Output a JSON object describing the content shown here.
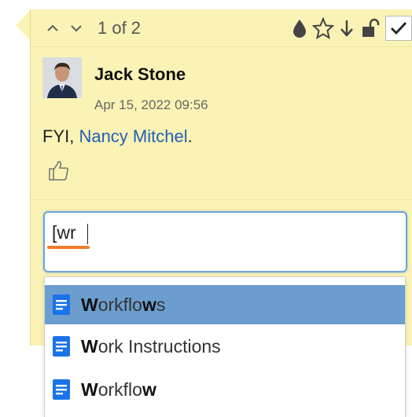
{
  "header": {
    "counter": "1 of 2",
    "icons": [
      "chevron-up-icon",
      "chevron-down-icon",
      "droplet-icon",
      "star-icon",
      "arrow-down-icon",
      "unlock-icon",
      "check-icon"
    ]
  },
  "comment": {
    "author": "Jack Stone",
    "date": "Apr 15, 2022 09:56",
    "text_prefix": "FYI, ",
    "mention": "Nancy Mitchel",
    "text_suffix": "."
  },
  "input": {
    "value": "[wr"
  },
  "suggestions": [
    {
      "pre": "",
      "b1": "W",
      "mid": "orkflo",
      "b2": "w",
      "post": "s",
      "selected": true
    },
    {
      "pre": "",
      "b1": "W",
      "mid": "ork Instructions",
      "b2": "",
      "post": "",
      "selected": false
    },
    {
      "pre": "",
      "b1": "W",
      "mid": "orkflo",
      "b2": "w",
      "post": "",
      "selected": false
    }
  ],
  "colors": {
    "panel": "#fbf3b5",
    "mention": "#1f5fb8",
    "selected_row": "#6b9dcf",
    "doc_icon": "#1a73e8",
    "input_border": "#6ea4db",
    "spell_underline": "#f07b2e"
  }
}
